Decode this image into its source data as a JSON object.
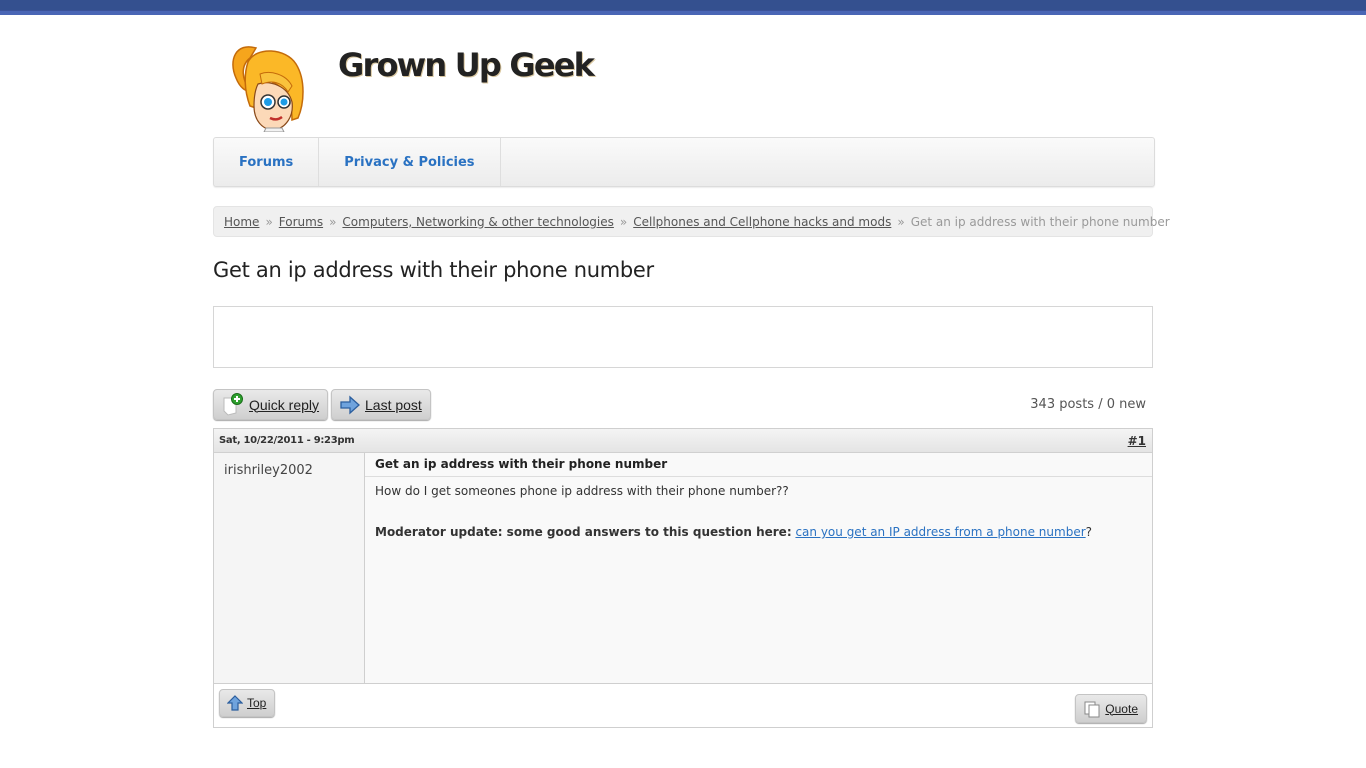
{
  "site": {
    "name": "Grown Up Geek",
    "logo_icon": "geek-girl-mascot"
  },
  "nav": {
    "items": [
      {
        "label": "Forums"
      },
      {
        "label": "Privacy & Policies"
      }
    ]
  },
  "breadcrumb": {
    "items": [
      {
        "label": "Home"
      },
      {
        "label": "Forums"
      },
      {
        "label": "Computers, Networking & other technologies"
      },
      {
        "label": "Cellphones and Cellphone hacks and mods"
      }
    ],
    "separator": "»",
    "current": "Get an ip address with their phone number"
  },
  "page": {
    "title": "Get an ip address with their phone number"
  },
  "actions": {
    "quick_reply": "Quick reply",
    "last_post": "Last post",
    "post_count": "343 posts / 0 new"
  },
  "post": {
    "date": "Sat, 10/22/2011 - 9:23pm",
    "number": "#1",
    "author": "irishriley2002",
    "subject": "Get an ip address with their phone number",
    "body": "How do I get someones phone ip address with their phone number??",
    "moderator_label": "Moderator update: some good answers to this question here:",
    "moderator_link": "can you get an IP address from a phone number",
    "moderator_suffix": "?",
    "top_label": "Top",
    "quote_label": "Quote"
  },
  "colors": {
    "topbar": "#3b5299",
    "nav_link": "#2a72c2",
    "link": "#2a72c2"
  }
}
